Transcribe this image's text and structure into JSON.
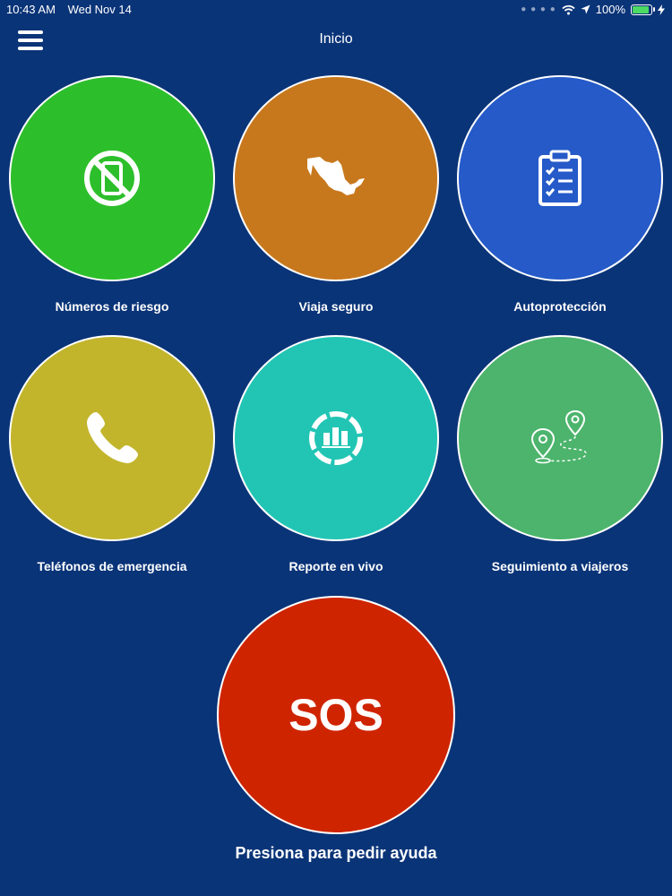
{
  "status_bar": {
    "time": "10:43 AM",
    "date": "Wed Nov 14",
    "battery": "100%",
    "battery_level": 1.0
  },
  "nav": {
    "title": "Inicio"
  },
  "tiles": [
    {
      "label": "Números de riesgo",
      "color": "#2dbf2b",
      "icon": "no-phone-icon"
    },
    {
      "label": "Viaja seguro",
      "color": "#c8781c",
      "icon": "mexico-map-icon"
    },
    {
      "label": "Autoprotección",
      "color": "#255ac8",
      "icon": "clipboard-checklist-icon"
    },
    {
      "label": "Teléfonos de emergencia",
      "color": "#c2b52c",
      "icon": "phone-icon"
    },
    {
      "label": "Reporte en vivo",
      "color": "#22c5b4",
      "icon": "live-report-chart-icon"
    },
    {
      "label": "Seguimiento a viajeros",
      "color": "#4cb46c",
      "icon": "route-pins-icon"
    }
  ],
  "sos": {
    "label": "SOS",
    "caption": "Presiona para pedir ayuda",
    "color": "#cf2400"
  }
}
